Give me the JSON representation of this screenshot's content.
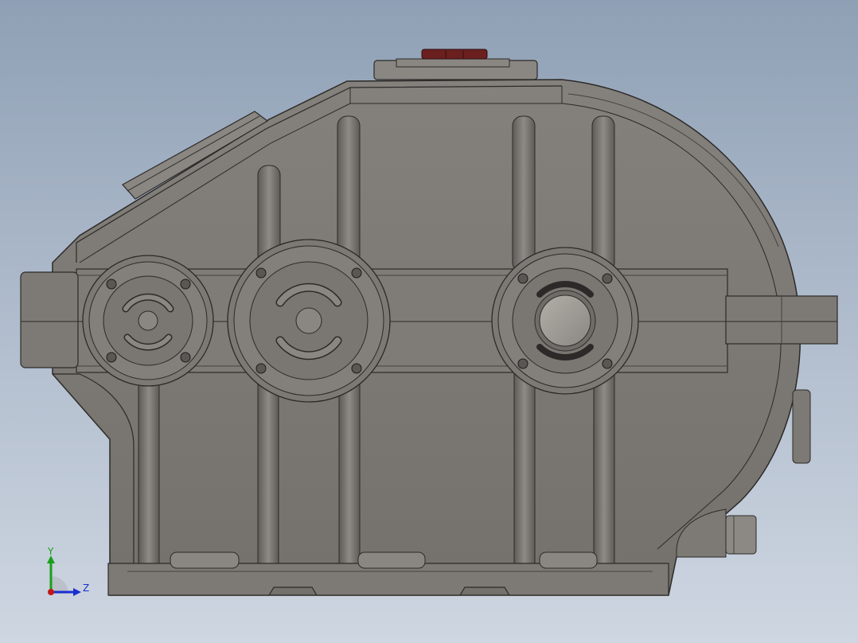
{
  "viewport": {
    "background_top": "#8fa0b5",
    "background_bottom": "#ced6e1"
  },
  "model": {
    "name": "gearbox-housing",
    "body_color": "#7a7773",
    "edge_color": "#2c2a28",
    "highlight_color": "#9a9792",
    "breather_color": "#6b1f1f",
    "bearing_caps": [
      {
        "id": "input-shaft",
        "style": "kidney-slots"
      },
      {
        "id": "intermediate-shaft",
        "style": "kidney-slots"
      },
      {
        "id": "output-shaft",
        "style": "open-bore"
      }
    ]
  },
  "triad": {
    "y_label": "Y",
    "z_label": "Z",
    "y_color": "#19a019",
    "z_color": "#1a2fd0",
    "x_color": "#c01818"
  }
}
